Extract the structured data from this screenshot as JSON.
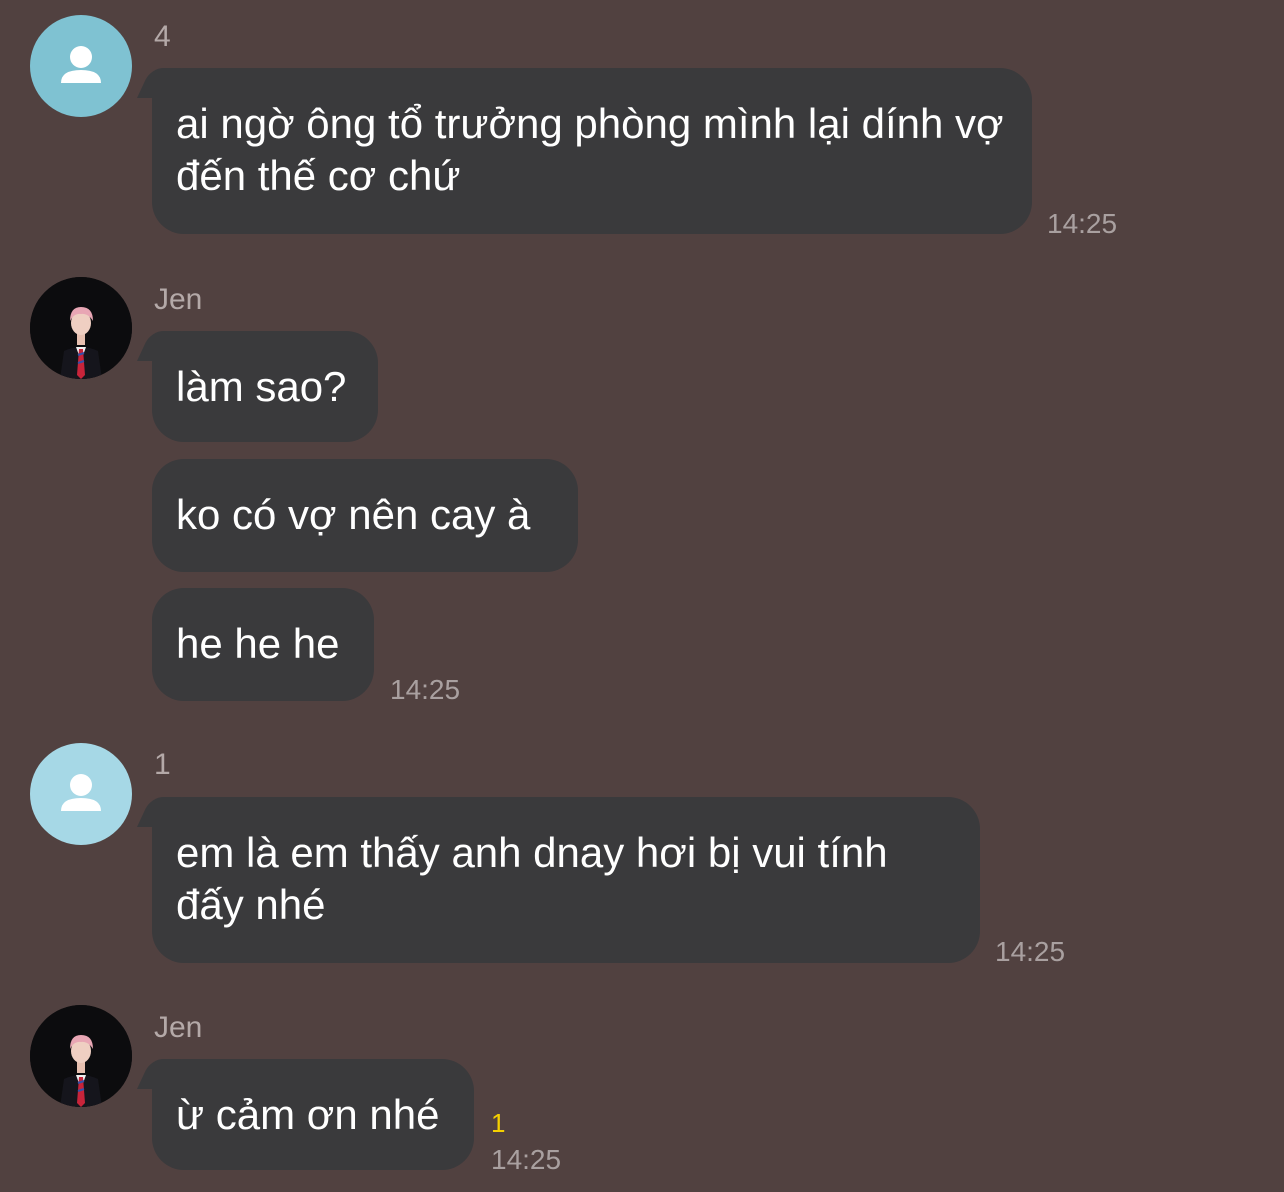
{
  "colors": {
    "background": "#514140",
    "bubble": "#3a3a3c",
    "unread": "#f5d000"
  },
  "messages": [
    {
      "sender": "4",
      "avatar": "default-avatar-icon",
      "bubbles": [
        "ai ngờ ông tổ trưởng phòng mình lại dính vợ đến thế cơ chứ"
      ],
      "time": "14:25"
    },
    {
      "sender": "Jen",
      "avatar": "profile-photo",
      "bubbles": [
        "làm sao?",
        "ko có vợ nên cay à",
        "he he he"
      ],
      "time": "14:25"
    },
    {
      "sender": "1",
      "avatar": "default-avatar-icon",
      "bubbles": [
        "em là em thấy anh dnay hơi bị vui tính đấy nhé"
      ],
      "time": "14:25"
    },
    {
      "sender": "Jen",
      "avatar": "profile-photo",
      "bubbles": [
        "ừ cảm ơn nhé"
      ],
      "unread": "1",
      "time": "14:25"
    }
  ]
}
